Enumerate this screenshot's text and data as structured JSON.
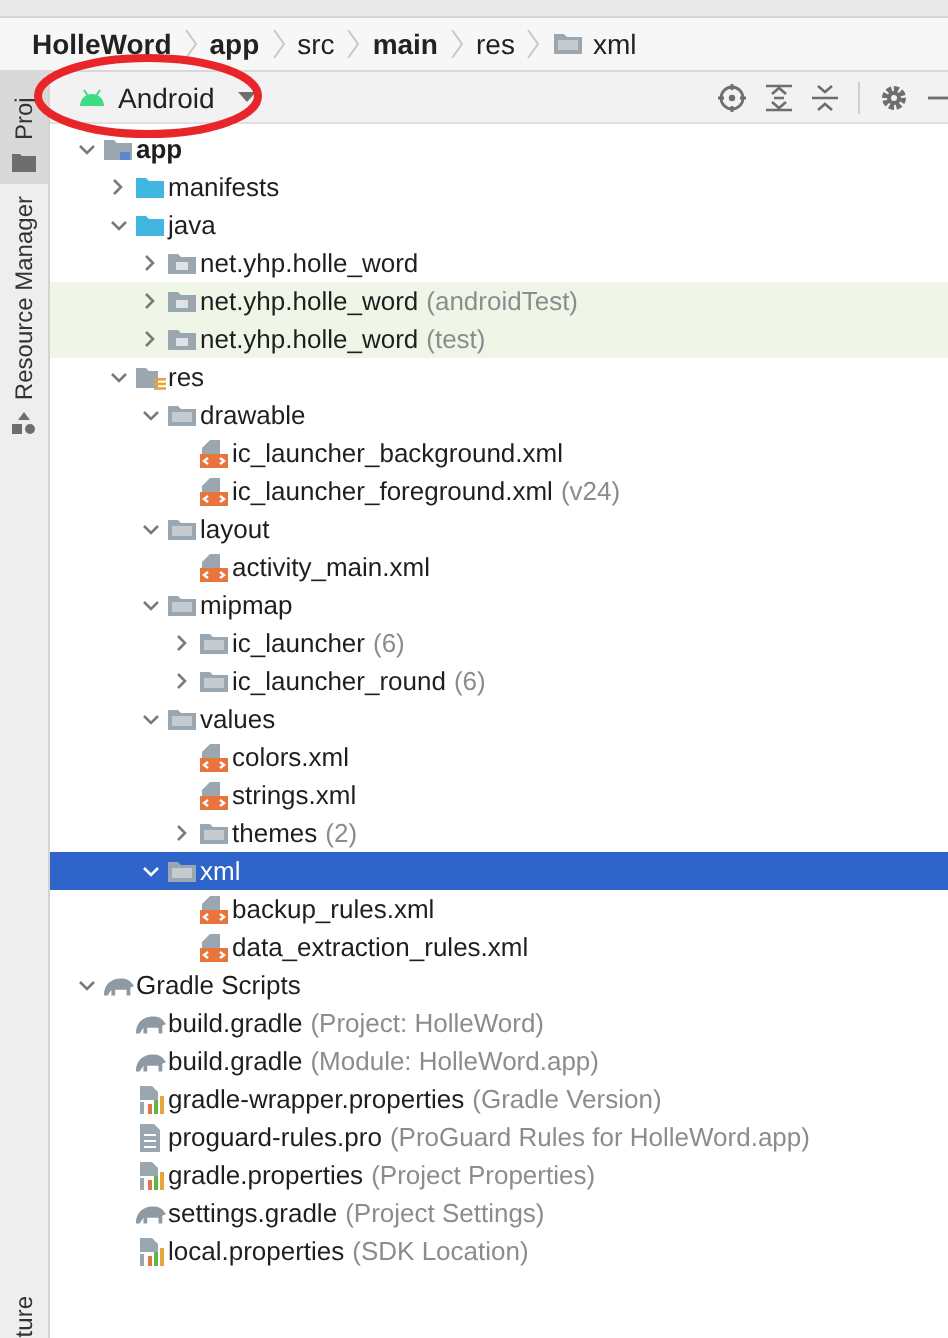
{
  "breadcrumb": [
    {
      "label": "HolleWord",
      "bold": true,
      "kind": "segment"
    },
    {
      "label": "app",
      "bold": true,
      "kind": "segment"
    },
    {
      "label": "src",
      "bold": false,
      "kind": "segment"
    },
    {
      "label": "main",
      "bold": true,
      "kind": "segment"
    },
    {
      "label": "res",
      "bold": false,
      "kind": "segment"
    },
    {
      "label": "xml",
      "bold": false,
      "kind": "folder"
    }
  ],
  "side_tabs": [
    {
      "label": "Proj",
      "kind": "project",
      "selected": true
    },
    {
      "label": "Resource Manager",
      "kind": "resources",
      "selected": false
    },
    {
      "label": "ture",
      "kind": "structure",
      "selected": false
    }
  ],
  "view_selector": {
    "label": "Android"
  },
  "annotation": {
    "kind": "ellipse"
  },
  "tree": [
    {
      "label": "app",
      "kind": "module",
      "bold": true,
      "expanded": true,
      "selected": false,
      "children": [
        {
          "label": "manifests",
          "kind": "source-folder",
          "expanded": false,
          "selected": false
        },
        {
          "label": "java",
          "kind": "source-folder",
          "expanded": true,
          "selected": false,
          "children": [
            {
              "label": "net.yhp.holle_word",
              "kind": "package",
              "expanded": false,
              "selected": false
            },
            {
              "label": "net.yhp.holle_word",
              "detail": "(androidTest)",
              "kind": "package",
              "test_source": true,
              "expanded": false,
              "selected": false
            },
            {
              "label": "net.yhp.holle_word",
              "detail": "(test)",
              "kind": "package",
              "test_source": true,
              "expanded": false,
              "selected": false
            }
          ]
        },
        {
          "label": "res",
          "kind": "res",
          "expanded": true,
          "selected": false,
          "children": [
            {
              "label": "drawable",
              "kind": "folder",
              "expanded": true,
              "selected": false,
              "children": [
                {
                  "label": "ic_launcher_background.xml",
                  "kind": "xml",
                  "selected": false
                },
                {
                  "label": "ic_launcher_foreground.xml",
                  "detail": "(v24)",
                  "kind": "xml",
                  "selected": false
                }
              ]
            },
            {
              "label": "layout",
              "kind": "folder",
              "expanded": true,
              "selected": false,
              "children": [
                {
                  "label": "activity_main.xml",
                  "kind": "xml",
                  "selected": false
                }
              ]
            },
            {
              "label": "mipmap",
              "kind": "folder",
              "expanded": true,
              "selected": false,
              "children": [
                {
                  "label": "ic_launcher",
                  "detail": "(6)",
                  "kind": "folder",
                  "expanded": false,
                  "selected": false
                },
                {
                  "label": "ic_launcher_round",
                  "detail": "(6)",
                  "kind": "folder",
                  "expanded": false,
                  "selected": false
                }
              ]
            },
            {
              "label": "values",
              "kind": "folder",
              "expanded": true,
              "selected": false,
              "children": [
                {
                  "label": "colors.xml",
                  "kind": "xml",
                  "selected": false
                },
                {
                  "label": "strings.xml",
                  "kind": "xml",
                  "selected": false
                },
                {
                  "label": "themes",
                  "detail": "(2)",
                  "kind": "folder",
                  "expanded": false,
                  "selected": false
                }
              ]
            },
            {
              "label": "xml",
              "kind": "folder",
              "expanded": true,
              "selected": true,
              "children": [
                {
                  "label": "backup_rules.xml",
                  "kind": "xml",
                  "selected": false
                },
                {
                  "label": "data_extraction_rules.xml",
                  "kind": "xml",
                  "selected": false
                }
              ]
            }
          ]
        }
      ]
    },
    {
      "label": "Gradle Scripts",
      "kind": "gradle",
      "expanded": true,
      "selected": false,
      "children": [
        {
          "label": "build.gradle",
          "detail": "(Project: HolleWord)",
          "kind": "gradle",
          "selected": false
        },
        {
          "label": "build.gradle",
          "detail": "(Module: HolleWord.app)",
          "kind": "gradle",
          "selected": false
        },
        {
          "label": "gradle-wrapper.properties",
          "detail": "(Gradle Version)",
          "kind": "properties",
          "selected": false
        },
        {
          "label": "proguard-rules.pro",
          "detail": "(ProGuard Rules for HolleWord.app)",
          "kind": "text",
          "selected": false
        },
        {
          "label": "gradle.properties",
          "detail": "(Project Properties)",
          "kind": "properties",
          "selected": false
        },
        {
          "label": "settings.gradle",
          "detail": "(Project Settings)",
          "kind": "gradle",
          "selected": false
        },
        {
          "label": "local.properties",
          "detail": "(SDK Location)",
          "kind": "properties",
          "selected": false
        }
      ]
    }
  ]
}
